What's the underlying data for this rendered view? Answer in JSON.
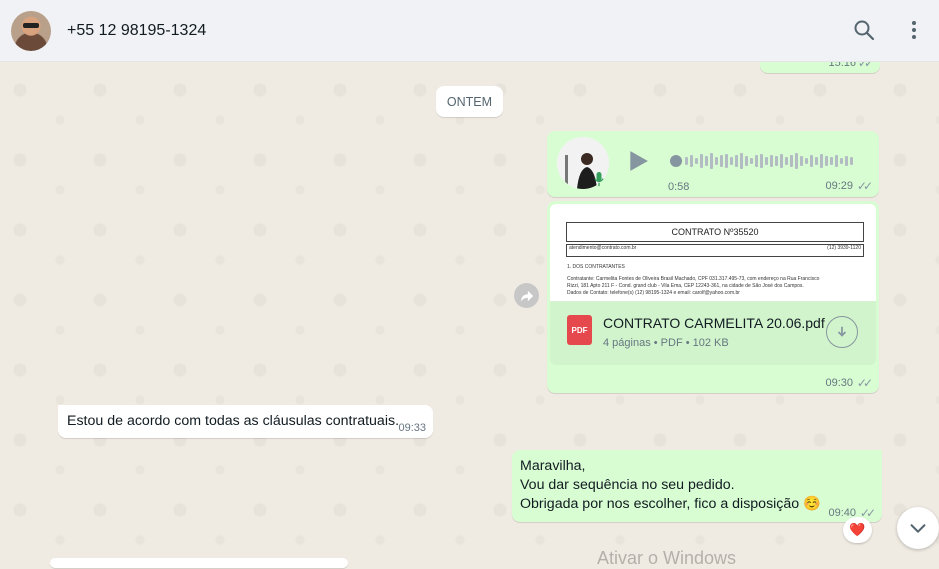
{
  "header": {
    "contact_name": "+55 12 98195-1324",
    "search_icon": "search-icon",
    "menu_icon": "more-vertical-icon"
  },
  "top_partial_message": {
    "time": "15:16"
  },
  "date_divider": "ONTEM",
  "audio_message": {
    "duration": "0:58",
    "time": "09:29"
  },
  "document_message": {
    "preview": {
      "heading": "CONTRATO Nº35520",
      "email_line": "atendimento@contrato.com.br",
      "phone_line": "(12) 3939-1120",
      "section": "1. DOS CONTRATANTES",
      "line1": "Contratante: Carmelita Fontes de Oliveira Brasil Machado, CPF 031.317.495-73, com endereço na Rua Francisco",
      "line2": "Rizzi, 181 Apto 211 F - Cond. grand club - Vila Ema, CEP 12243-361, na cidade de São José dos Campos.",
      "line3": "Dados de Contato: telefone(s) (12) 98195-1324 e email: carolf@yahoo.com.br"
    },
    "file_icon": "PDF",
    "file_name": "CONTRATO CARMELITA 20.06.pdf",
    "file_meta": "4 páginas • PDF • 102 KB",
    "time": "09:30"
  },
  "incoming_message": {
    "text": "Estou de acordo com todas as cláusulas contratuais.",
    "time": "09:33"
  },
  "outgoing_message": {
    "line1": "Maravilha,",
    "line2": "Vou dar sequência no seu pedido.",
    "line3": "Obrigada por nos escolher, fico a disposição",
    "emoji": "☺️",
    "time": "09:40",
    "reaction": "❤️"
  },
  "watermark": "Ativar o Windows",
  "colors": {
    "outgoing_bubble": "#d9fdd3",
    "header_bg": "#f0f2f5",
    "chat_bg": "#efeae2",
    "pdf_red": "#e5484d"
  }
}
